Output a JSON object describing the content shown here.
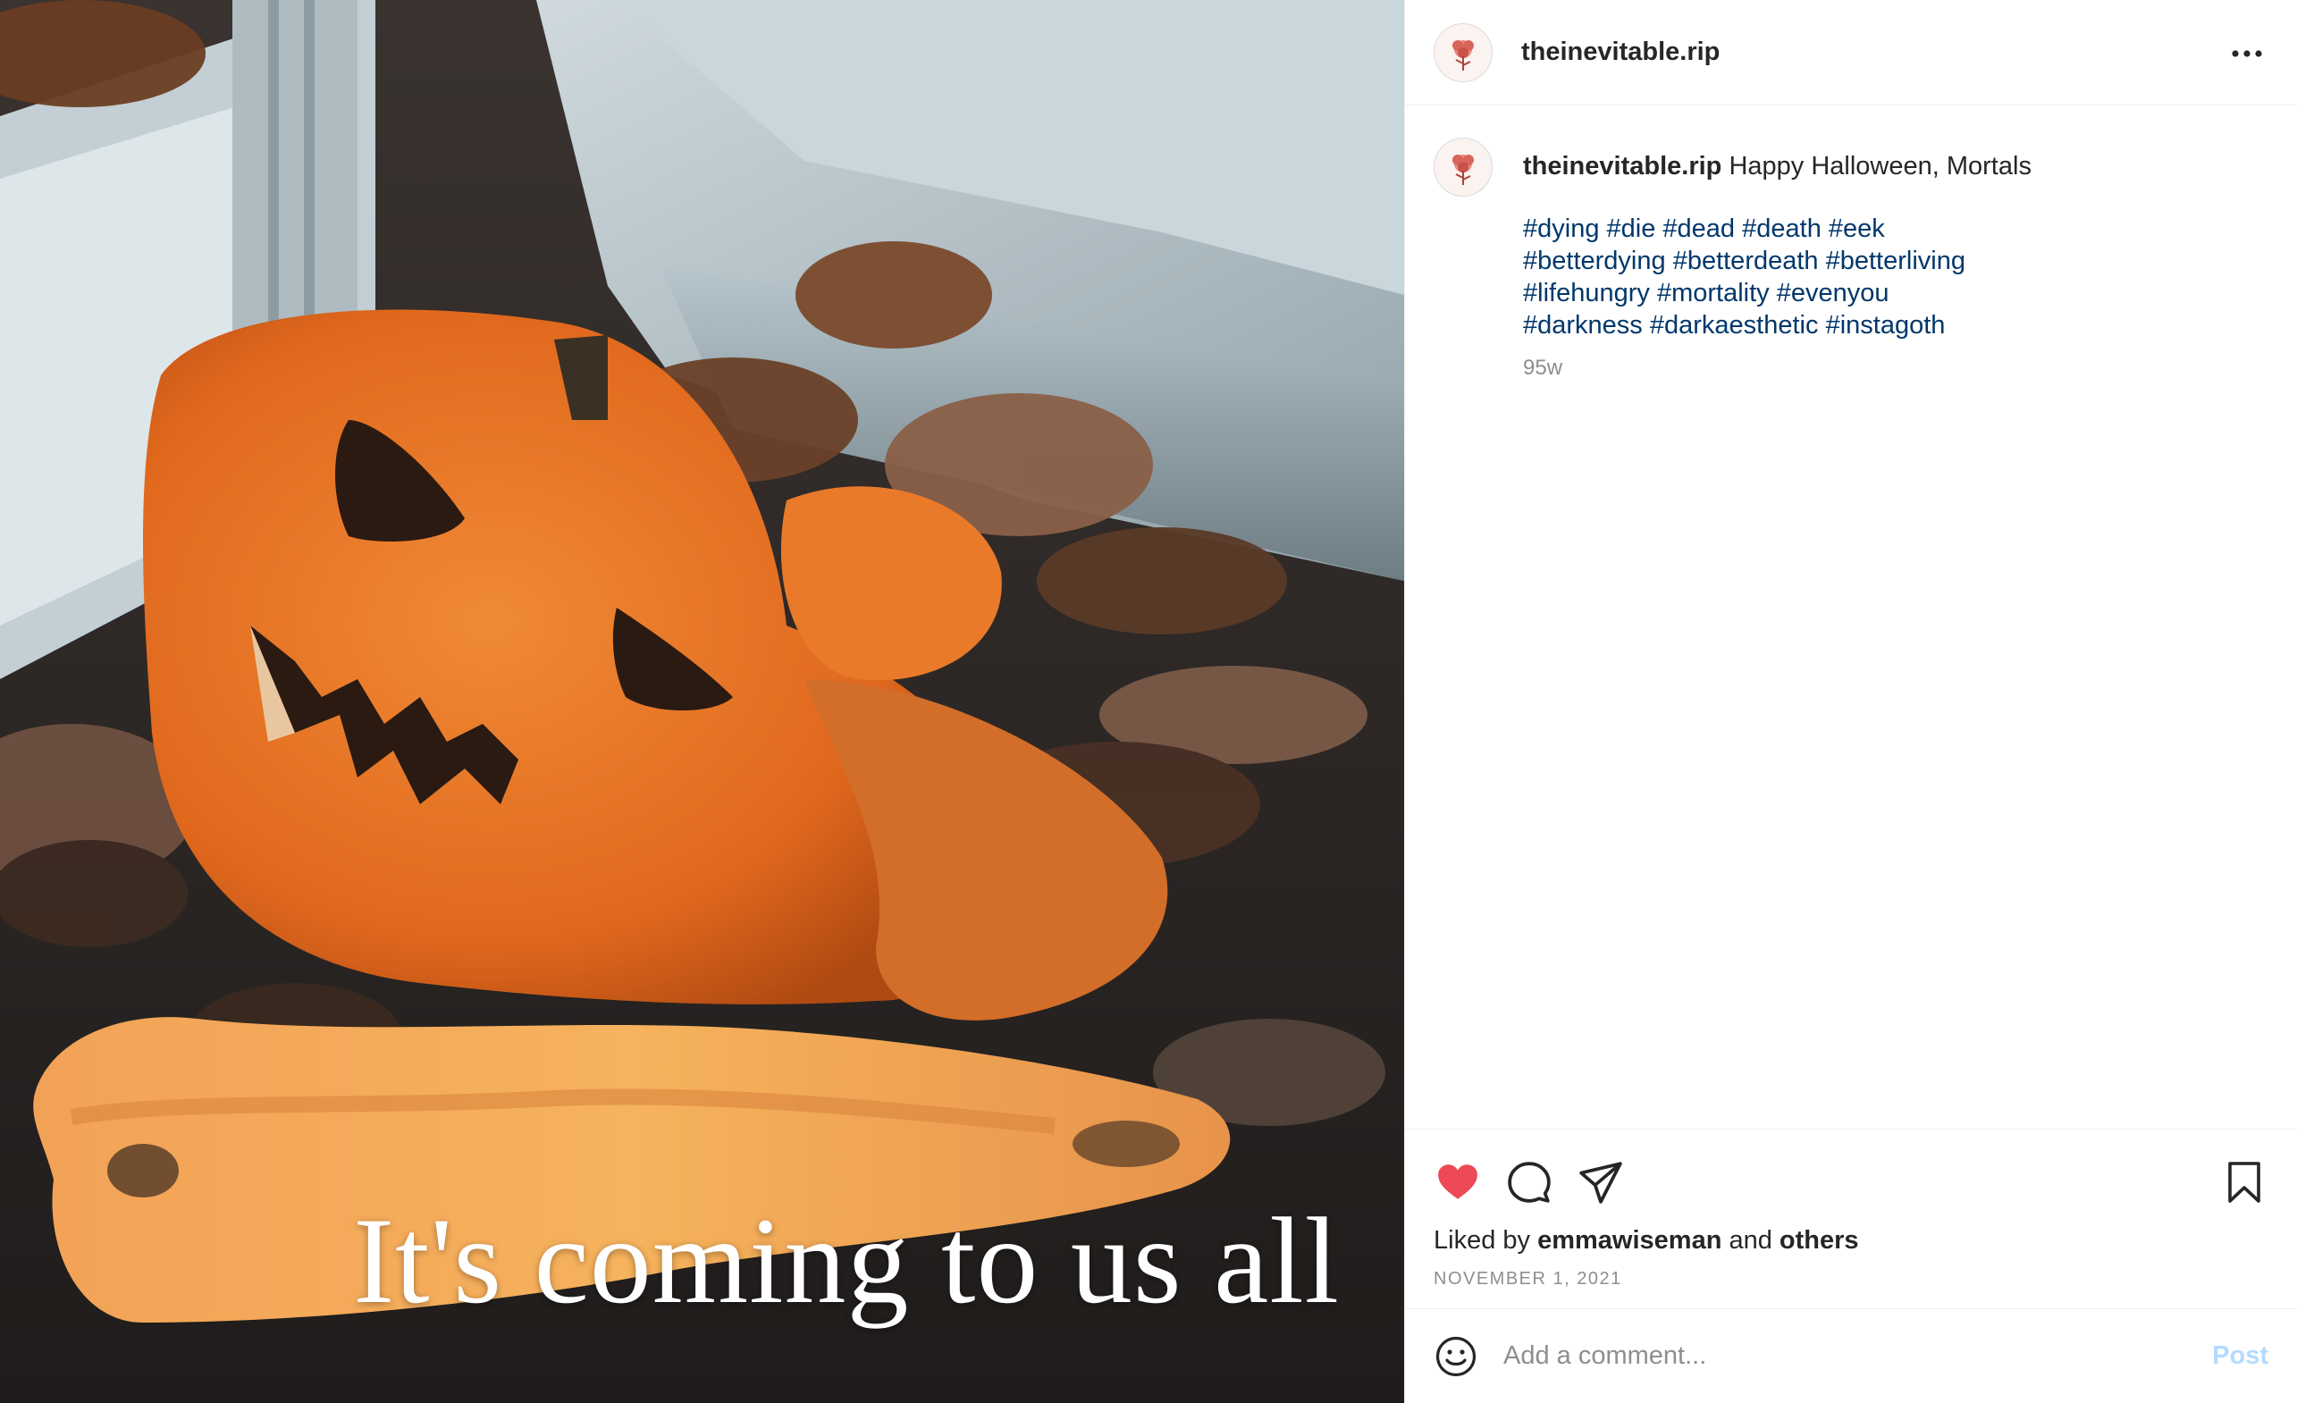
{
  "post": {
    "image_overlay_text": "It's coming to us all"
  },
  "header": {
    "username": "theinevitable.rip",
    "more_icon": "more-horizontal-icon"
  },
  "caption": {
    "username": "theinevitable.rip",
    "text": "Happy Halloween, Mortals",
    "hashtag_lines": [
      [
        "#dying",
        "#die",
        "#dead",
        "#death",
        "#eek"
      ],
      [
        "#betterdying",
        "#betterdeath",
        "#betterliving"
      ],
      [
        "#lifehungry",
        "#mortality",
        "#evenyou"
      ],
      [
        "#darkness",
        "#darkaesthetic",
        "#instagoth"
      ]
    ],
    "time_ago": "95w"
  },
  "actions": {
    "like_icon": "heart-filled-icon",
    "comment_icon": "comment-icon",
    "share_icon": "share-icon",
    "save_icon": "bookmark-icon",
    "like_color": "#ed4956"
  },
  "likes": {
    "prefix": "Liked by",
    "user": "emmawiseman",
    "conjunction": "and",
    "others": "others"
  },
  "date": "NOVEMBER 1, 2021",
  "comment": {
    "emoji_icon": "emoji-icon",
    "placeholder": "Add a comment...",
    "post_label": "Post"
  }
}
